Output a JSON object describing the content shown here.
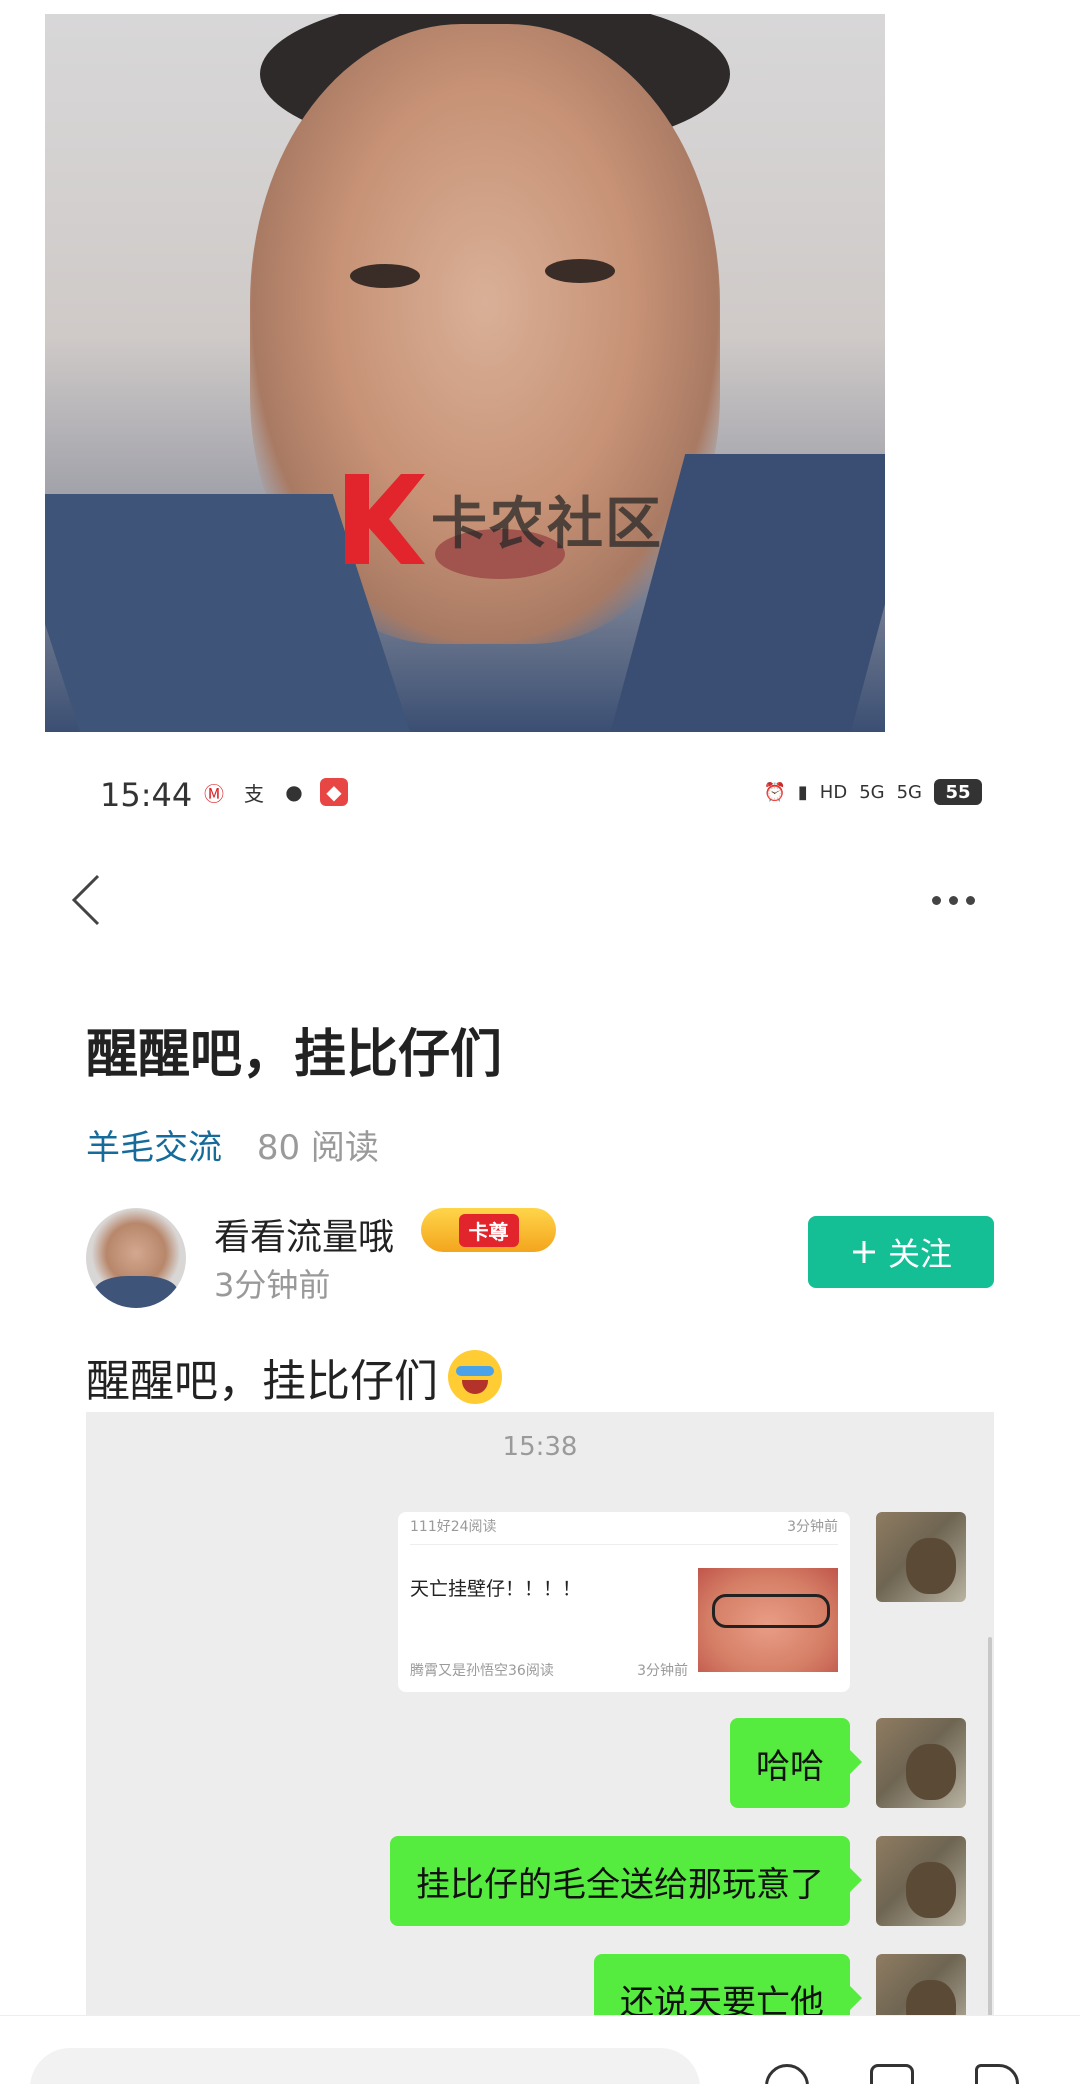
{
  "status": {
    "time": "15:44",
    "battery": "55",
    "network": [
      "HD",
      "5G",
      "5G"
    ]
  },
  "photo": {
    "watermark_text": "卡农社区"
  },
  "post": {
    "title": "醒醒吧，挂比仔们",
    "category": "羊毛交流",
    "reads": "80 阅读",
    "author": "看看流量哦",
    "badge": "卡尊",
    "time": "3分钟前",
    "follow_label": "关注",
    "text": "醒醒吧，挂比仔们"
  },
  "chat": {
    "time": "15:38",
    "card": {
      "head_left": "111好24阅读",
      "head_right": "3分钟前",
      "title": "天亡挂壁仔！！！！",
      "foot_left": "腾霄又是孙悟空36阅读",
      "foot_right": "3分钟前"
    },
    "messages": [
      "哈哈",
      "挂比仔的毛全送给那玩意了",
      "还说天要亡他"
    ]
  },
  "colors": {
    "accent": "#14bf96",
    "category": "#166b9a",
    "bubble": "#56ec3f"
  },
  "icons": [
    "back-icon",
    "more-icon",
    "plus-icon",
    "cry-emoji-icon"
  ]
}
